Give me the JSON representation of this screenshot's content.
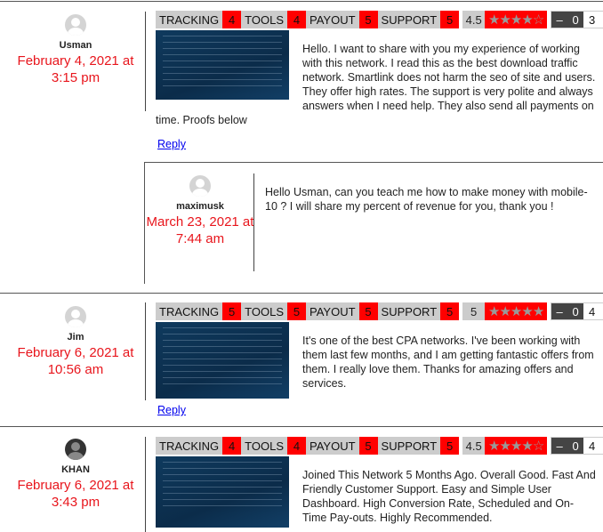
{
  "rating_labels": {
    "tracking": "TRACKING",
    "tools": "TOOLS",
    "payout": "PAYOUT",
    "support": "SUPPORT",
    "minus": "–",
    "plus": "+"
  },
  "comments": [
    {
      "author": "Usman",
      "date": "February 4, 2021 at",
      "time": "3:15 pm",
      "avatar": "default-avatar",
      "tracking": "4",
      "tools": "4",
      "payout": "5",
      "support": "5",
      "score": "4.5",
      "stars": "★★★★☆",
      "stars_value": 4.5,
      "votes": "0",
      "count": "3",
      "text": "Hello. I want to share with you my experience of working with this network. I read this as the best download traffic network. Smartlink does not harm the seo of site and users. They offer high rates. The support is very polite and always answers when I need help. They also send all payments on",
      "text_wrap": "time. Proofs below",
      "reply": "Reply"
    },
    {
      "author": "Jim",
      "date": "February 6, 2021 at",
      "time": "10:56 am",
      "avatar": "default-avatar",
      "tracking": "5",
      "tools": "5",
      "payout": "5",
      "support": "5",
      "score": "5",
      "stars": "★★★★★",
      "stars_value": 5,
      "votes": "0",
      "count": "4",
      "text": "It's one of the best CPA networks. I've been working with them last few months, and I am getting fantastic offers from them. I really love them. Thanks for amazing offers and services.",
      "reply": "Reply"
    },
    {
      "author": "KHAN",
      "date": "February 6, 2021 at",
      "time": "3:43 pm",
      "avatar": "photo-avatar",
      "tracking": "4",
      "tools": "4",
      "payout": "5",
      "support": "5",
      "score": "4.5",
      "stars": "★★★★☆",
      "stars_value": 4.5,
      "votes": "0",
      "count": "4",
      "text": "Joined This Network 5 Months Ago. Overall Good. Fast And Friendly Customer Support. Easy and Simple User Dashboard. High Conversion Rate, Scheduled and On-Time Pay-outs. Highly Recommended."
    }
  ],
  "reply_comment": {
    "author": "maximusk",
    "date": "March 23, 2021 at",
    "time": "7:44 am",
    "text": "Hello Usman, can you teach me how to make money with mobile-10 ? I will share my percent of revenue for you, thank you !"
  }
}
